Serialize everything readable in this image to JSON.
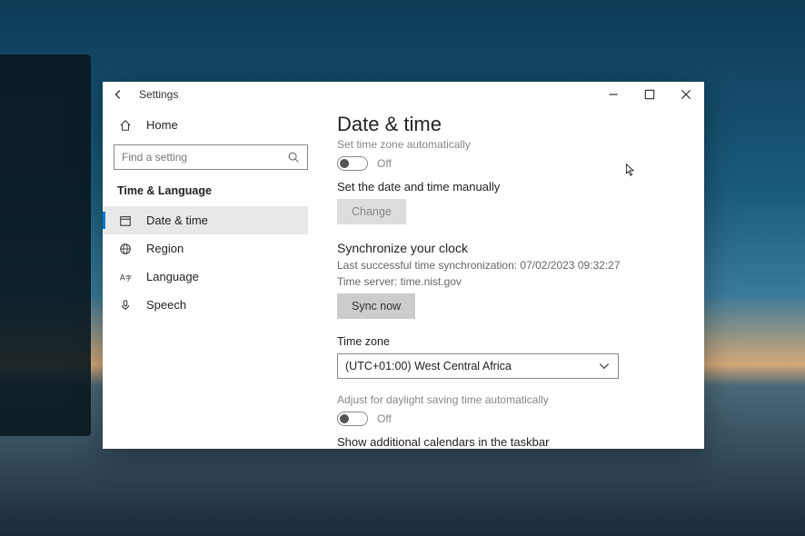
{
  "titlebar": {
    "title": "Settings"
  },
  "sidebar": {
    "home_label": "Home",
    "search_placeholder": "Find a setting",
    "section_title": "Time & Language",
    "items": [
      {
        "label": "Date & time"
      },
      {
        "label": "Region"
      },
      {
        "label": "Language"
      },
      {
        "label": "Speech"
      }
    ]
  },
  "content": {
    "heading": "Date & time",
    "auto_tz_label": "Set time zone automatically",
    "toggle_off": "Off",
    "manual_label": "Set the date and time manually",
    "change_btn": "Change",
    "sync_heading": "Synchronize your clock",
    "sync_status": "Last successful time synchronization: 07/02/2023 09:32:27",
    "sync_server": "Time server: time.nist.gov",
    "sync_btn": "Sync now",
    "tz_label": "Time zone",
    "tz_value": "(UTC+01:00) West Central Africa",
    "dst_label": "Adjust for daylight saving time automatically",
    "calendars_label": "Show additional calendars in the taskbar"
  }
}
